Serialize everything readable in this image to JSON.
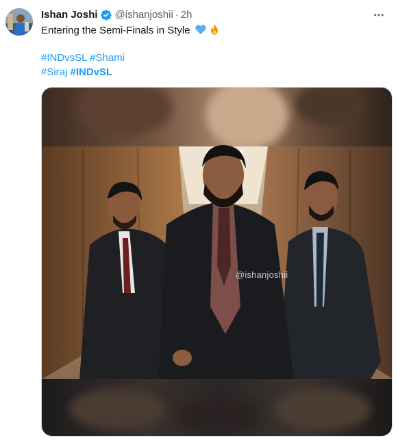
{
  "post": {
    "author": {
      "display_name": "Ishan Joshi",
      "handle": "@ishanjoshii",
      "separator": "·",
      "time": "2h",
      "verified": true,
      "avatar_icon": "profile-avatar"
    },
    "text": {
      "line1": "Entering the Semi-Finals in Style",
      "emojis": [
        "blue-heart",
        "fire"
      ],
      "hashtags_line1": [
        "#INDvsSL",
        "#Shami"
      ],
      "hashtags_line2": [
        "#Siraj",
        "#INDvSL"
      ]
    },
    "media": {
      "type": "image",
      "subject": "Three men in dark suits walking down a corridor",
      "watermark": "@ishanjoshii"
    },
    "more_icon": "more-horizontal-icon"
  },
  "colors": {
    "link": "#1d9bf0",
    "text": "#0f1419",
    "muted": "#536471",
    "verified": "#1d9bf0"
  }
}
